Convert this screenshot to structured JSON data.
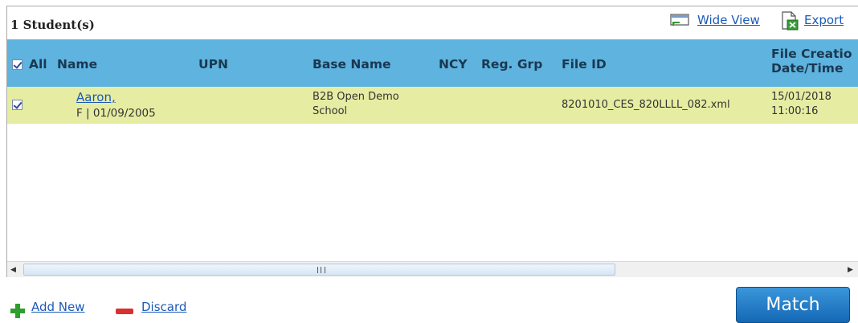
{
  "toolbar": {
    "student_count": "1 Student(s)",
    "wide_view_label": "Wide View",
    "export_label": "Export"
  },
  "table": {
    "columns": {
      "all": "All",
      "name": "Name",
      "upn": "UPN",
      "base_name": "Base Name",
      "ncy": "NCY",
      "reg_grp": "Reg. Grp",
      "file_id": "File ID",
      "file_creation_line1": "File Creatio",
      "file_creation_line2": "Date/Time"
    },
    "rows": [
      {
        "name": "Aaron,",
        "gender_dob": "F | 01/09/2005",
        "upn": "",
        "base_name_line1": "B2B Open Demo",
        "base_name_line2": "School",
        "ncy": "",
        "reg_grp": "",
        "file_id": "8201010_CES_820LLLL_082.xml",
        "date": "15/01/2018",
        "time": "11:00:16",
        "checked": true
      }
    ]
  },
  "footer": {
    "add_new_label": "Add New",
    "discard_label": "Discard",
    "match_label": "Match"
  },
  "colors": {
    "header_bg": "#5fb3df",
    "row_bg": "#e6eda2",
    "link": "#1c5ab8",
    "match_button": "#1f78c4"
  },
  "icons": [
    "wide-view-icon",
    "export-icon",
    "add-icon",
    "discard-icon",
    "scroll-left-icon",
    "scroll-right-icon"
  ]
}
